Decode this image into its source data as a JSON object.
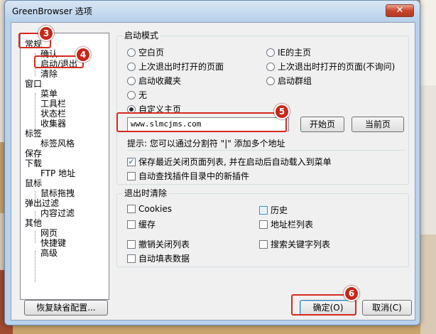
{
  "window": {
    "title": "GreenBrowser 选项",
    "close_label": "✕"
  },
  "tree": {
    "items": [
      {
        "label": "常规",
        "level": 0
      },
      {
        "label": "确认",
        "level": 1
      },
      {
        "label": "启动/退出",
        "level": 1
      },
      {
        "label": "清除",
        "level": 1
      },
      {
        "label": "窗口",
        "level": 0
      },
      {
        "label": "菜单",
        "level": 1
      },
      {
        "label": "工具栏",
        "level": 1
      },
      {
        "label": "状态栏",
        "level": 1
      },
      {
        "label": "收集器",
        "level": 1
      },
      {
        "label": "标签",
        "level": 0
      },
      {
        "label": "标签风格",
        "level": 1
      },
      {
        "label": "保存",
        "level": 0
      },
      {
        "label": "下载",
        "level": 0
      },
      {
        "label": "FTP 地址",
        "level": 1
      },
      {
        "label": "鼠标",
        "level": 0
      },
      {
        "label": "鼠标拖拽",
        "level": 1
      },
      {
        "label": "弹出过滤",
        "level": 0
      },
      {
        "label": "内容过滤",
        "level": 1
      },
      {
        "label": "其他",
        "level": 0
      },
      {
        "label": "网页",
        "level": 1
      },
      {
        "label": "快捷键",
        "level": 1
      },
      {
        "label": "高级",
        "level": 1
      }
    ]
  },
  "startup": {
    "title": "启动模式",
    "options": [
      {
        "label": "空白页",
        "checked": false
      },
      {
        "label": "IE的主页",
        "checked": false
      },
      {
        "label": "上次退出时打开的页面",
        "checked": false
      },
      {
        "label": "上次退出时打开的页面(不询问)",
        "checked": false
      },
      {
        "label": "启动收藏夹",
        "checked": false
      },
      {
        "label": "启动群组",
        "checked": false
      },
      {
        "label": "无",
        "checked": false
      },
      {
        "label": "自定义主页",
        "checked": true
      }
    ],
    "home_value": "www.slmcjms.com",
    "open_page_label": "开始页",
    "current_page_label": "当前页",
    "hint": "提示: 您可以通过分割符 \"|\" 添加多个地址",
    "save_closed_label": "保存最近关闭页面列表, 并在启动后自动载入到菜单",
    "save_closed_checked": true,
    "auto_plugins_label": "自动查找插件目录中的新插件",
    "auto_plugins_checked": false
  },
  "exit_clear": {
    "title": "退出时清除",
    "items": [
      {
        "label": "Cookies",
        "checked": false
      },
      {
        "label": "历史",
        "checked": false
      },
      {
        "label": "缓存",
        "checked": false
      },
      {
        "label": "地址栏列表",
        "checked": false
      },
      {
        "label": "撤销关闭列表",
        "checked": false
      },
      {
        "label": "搜索关键字列表",
        "checked": false
      },
      {
        "label": "自动填表数据",
        "checked": false
      }
    ]
  },
  "footer": {
    "restore_label": "恢复缺省配置...",
    "ok_label": "确定(O)",
    "cancel_label": "取消(C)"
  },
  "annotations": [
    "3",
    "4",
    "5",
    "6"
  ],
  "colors": {
    "highlight": "#d62a1e",
    "badge": "#c7261a",
    "window_frame": "#b9d1ea"
  }
}
